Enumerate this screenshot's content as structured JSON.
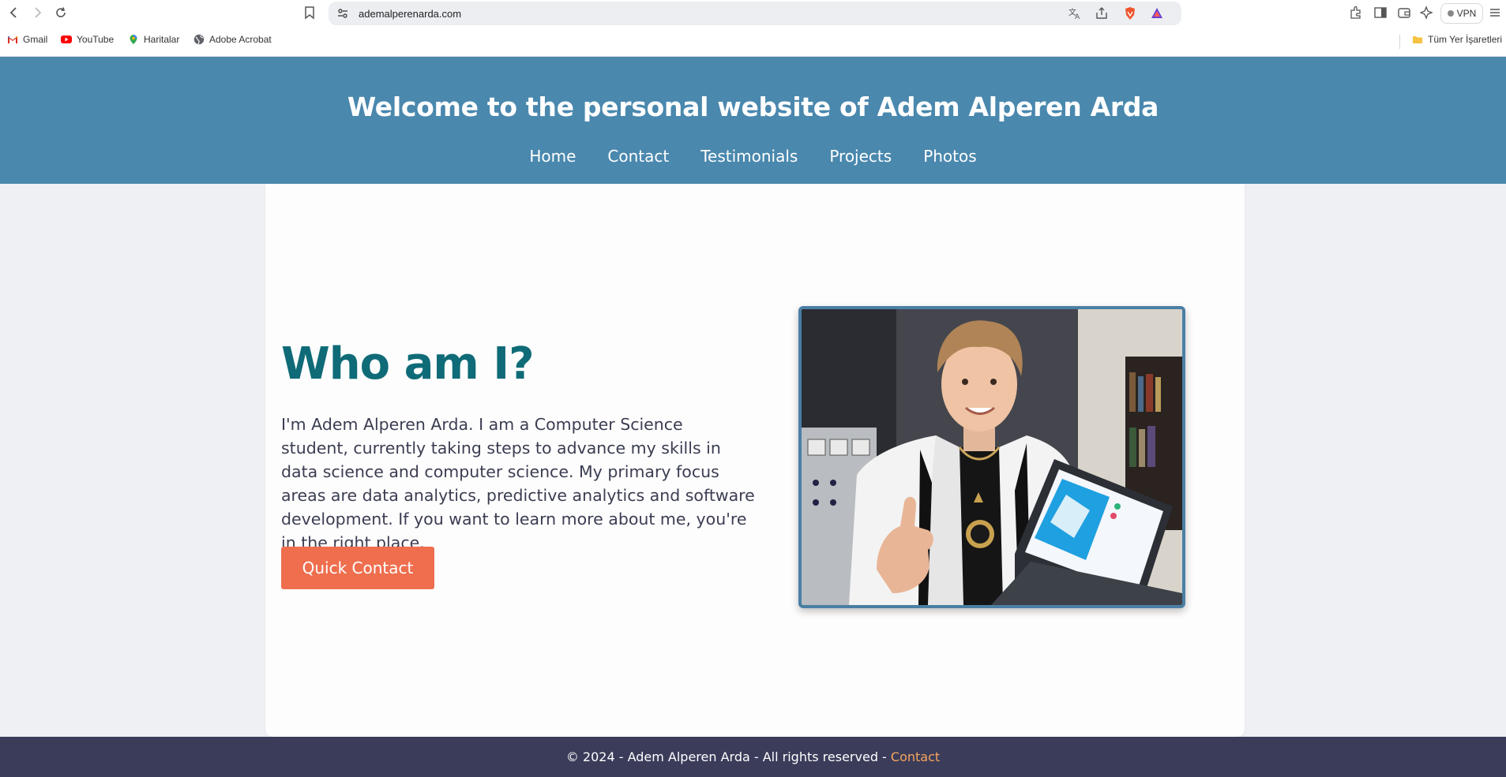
{
  "browser": {
    "url": "ademalperenarda.com",
    "vpn_label": "VPN",
    "bookmarks": [
      {
        "label": "Gmail",
        "icon": "gmail-icon"
      },
      {
        "label": "YouTube",
        "icon": "youtube-icon"
      },
      {
        "label": "Haritalar",
        "icon": "maps-icon"
      },
      {
        "label": "Adobe Acrobat",
        "icon": "globe-icon"
      }
    ],
    "all_bookmarks_label": "Tüm Yer İşaretleri"
  },
  "header": {
    "title": "Welcome to the personal website of Adem Alperen Arda",
    "nav": [
      "Home",
      "Contact",
      "Testimonials",
      "Projects",
      "Photos"
    ],
    "background_color": "#4a88ae"
  },
  "hero": {
    "heading": "Who am I?",
    "bio": "I'm Adem Alperen Arda. I am a Computer Science student, currently taking steps to advance my skills in data science and computer science. My primary focus areas are data analytics, predictive analytics and software development. If you want to learn more about me, you're in the right place.",
    "button_label": "Quick Contact",
    "heading_color": "#0f6b77",
    "button_color": "#ee6e4e"
  },
  "footer": {
    "text": "© 2024 - Adem Alperen Arda - All rights reserved - ",
    "link_label": "Contact",
    "link_color": "#f6a55c"
  }
}
